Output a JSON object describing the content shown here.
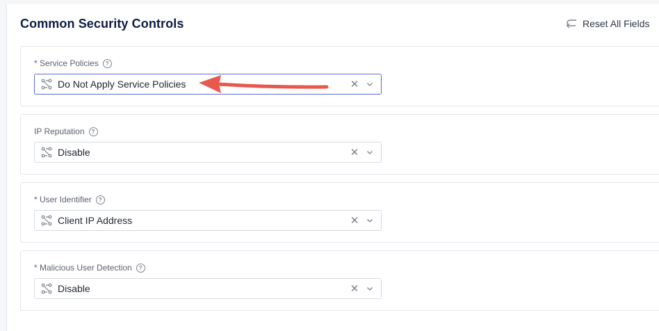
{
  "section": {
    "title": "Common Security Controls",
    "reset_label": "Reset All Fields"
  },
  "fields": [
    {
      "label": "* Service Policies",
      "value": "Do Not Apply Service Policies"
    },
    {
      "label": "IP Reputation",
      "value": "Disable"
    },
    {
      "label": "* User Identifier",
      "value": "Client IP Address"
    },
    {
      "label": "* Malicious User Detection",
      "value": "Disable"
    }
  ],
  "icons": {
    "help": "question-circle-icon",
    "select": "node-graph-icon",
    "clear": "close-icon",
    "dropdown": "chevron-down-icon",
    "reset": "undo-arrow-icon"
  },
  "colors": {
    "title": "#0e1c44",
    "focus_border": "#5b6bd5",
    "annotation_arrow": "#e8584d"
  }
}
